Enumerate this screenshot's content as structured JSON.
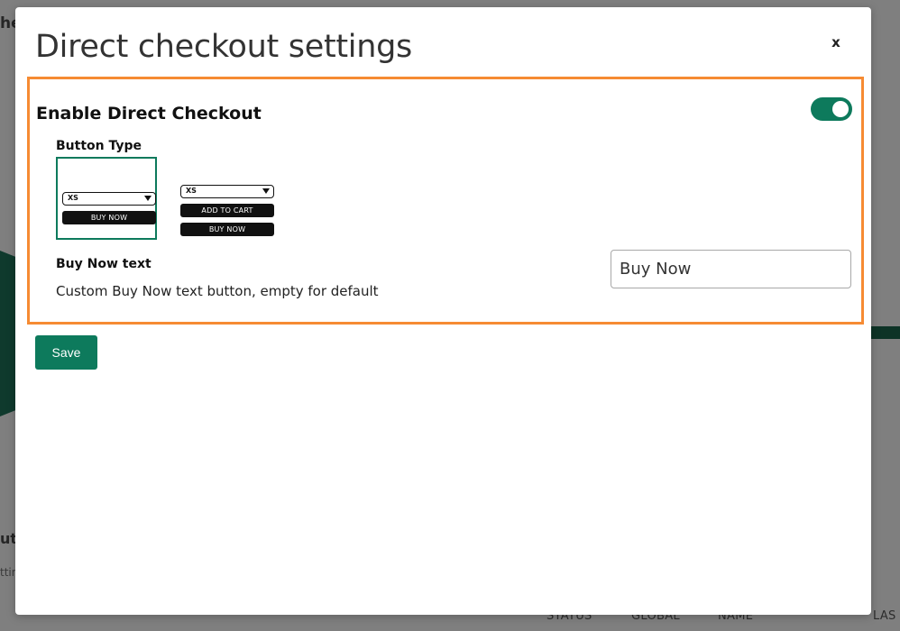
{
  "background": {
    "heading_fragment": "hec",
    "fragment_ut": "ut",
    "fragment_ttin": "ttin",
    "columns": [
      "STATUS",
      "GLOBAL",
      "NAME",
      "LAS"
    ]
  },
  "modal": {
    "title": "Direct checkout settings",
    "close_label": "x",
    "setting": {
      "title": "Enable Direct Checkout",
      "enabled": true,
      "button_type_label": "Button Type",
      "options": [
        {
          "select_value": "XS",
          "buttons": [
            "BUY NOW"
          ],
          "selected": true
        },
        {
          "select_value": "XS",
          "buttons": [
            "ADD TO CART",
            "BUY NOW"
          ],
          "selected": false
        }
      ],
      "buy_now_text_label": "Buy Now text",
      "buy_now_text_description": "Custom Buy Now text button, empty for default",
      "buy_now_text_value": "Buy Now"
    },
    "save_label": "Save"
  },
  "colors": {
    "accent_green": "#0d7a5c",
    "highlight_orange": "#f68b33",
    "overlay_gray": "#7f7f7f"
  }
}
